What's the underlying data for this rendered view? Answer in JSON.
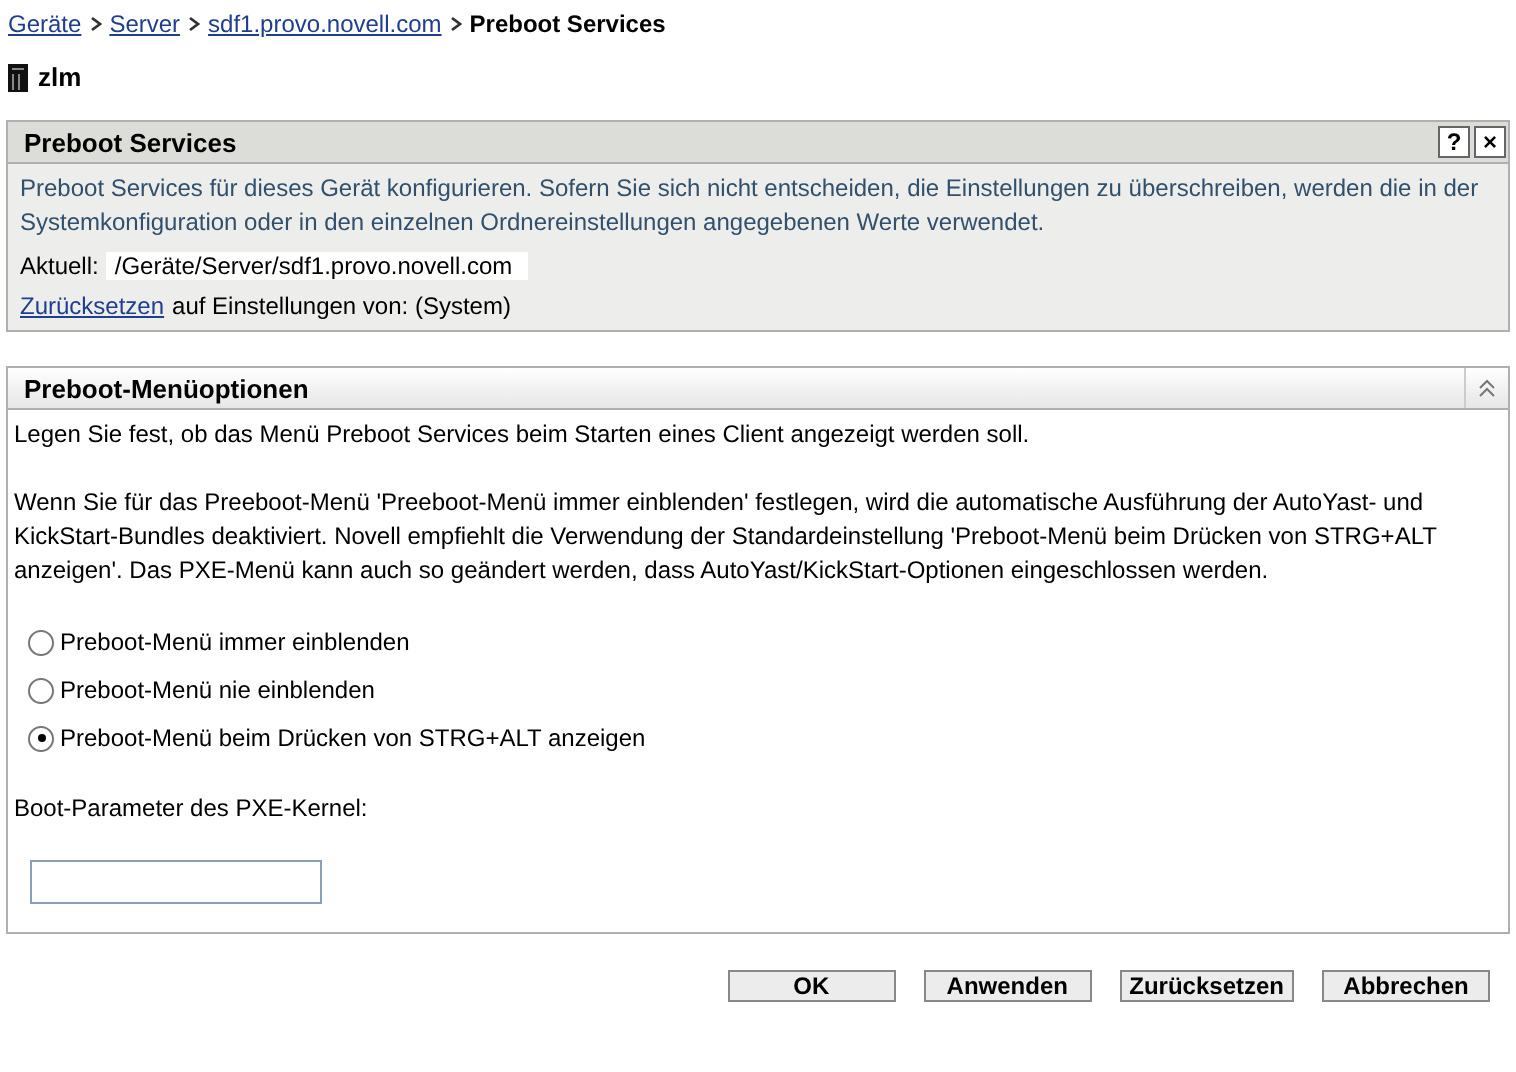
{
  "breadcrumb": [
    {
      "label": "Geräte",
      "link": true
    },
    {
      "label": "Server",
      "link": true
    },
    {
      "label": "sdf1.provo.novell.com",
      "link": true
    },
    {
      "label": "Preboot Services",
      "link": false
    }
  ],
  "device": {
    "name": "zlm"
  },
  "info_panel": {
    "title": "Preboot Services",
    "help": "?",
    "close": "×",
    "description": "Preboot Services für dieses Gerät konfigurieren. Sofern Sie sich nicht entscheiden, die Einstellungen zu überschreiben, werden die in der Systemkonfiguration oder in den einzelnen Ordnereinstellungen angegebenen Werte verwendet.",
    "current_label": "Aktuell:",
    "current_path": "/Geräte/Server/sdf1.provo.novell.com",
    "reset_link": "Zurücksetzen",
    "reset_text": "auf Einstellungen von: (System)"
  },
  "menu_panel": {
    "title": "Preboot-Menüoptionen",
    "expanded": true,
    "intro": "Legen Sie fest, ob das Menü Preboot Services beim Starten eines Client angezeigt werden soll.",
    "details": "Wenn Sie für das Preeboot-Menü 'Preeboot-Menü immer einblenden' festlegen, wird die automatische Ausführung der AutoYast- und KickStart-Bundles deaktiviert. Novell empfiehlt die Verwendung der Standardeinstellung 'Preboot-Menü beim Drücken von STRG+ALT anzeigen'. Das PXE-Menü kann auch so geändert werden, dass AutoYast/KickStart-Optionen eingeschlossen werden.",
    "options": [
      {
        "label": "Preboot-Menü immer einblenden",
        "selected": false
      },
      {
        "label": "Preboot-Menü nie einblenden",
        "selected": false
      },
      {
        "label": "Preboot-Menü beim Drücken von STRG+ALT anzeigen",
        "selected": true
      }
    ],
    "kernel_label": "Boot-Parameter des PXE-Kernel:"
  },
  "buttons": [
    "OK",
    "Anwenden",
    "Zurücksetzen",
    "Abbrechen"
  ]
}
